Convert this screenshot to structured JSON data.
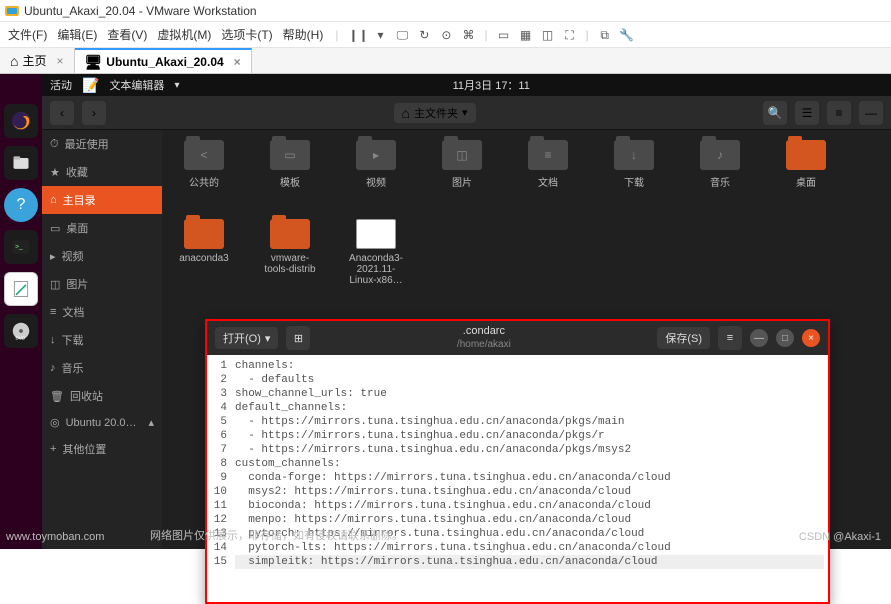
{
  "vm": {
    "title": "Ubuntu_Akaxi_20.04 - VMware Workstation",
    "menu": [
      "文件(F)",
      "编辑(E)",
      "查看(V)",
      "虚拟机(M)",
      "选项卡(T)",
      "帮助(H)"
    ],
    "tabs": {
      "home": "主页",
      "active": "Ubuntu_Akaxi_20.04"
    }
  },
  "ubuntu": {
    "topbar": {
      "activities": "活动",
      "app": "文本编辑器",
      "datetime": "11月3日 17：11"
    },
    "fm": {
      "location_btn": "主文件夹",
      "sidebar": {
        "recent": "最近使用",
        "starred": "收藏",
        "home": "主目录",
        "desktop": "桌面",
        "videos": "视频",
        "pictures": "图片",
        "documents": "文档",
        "downloads": "下载",
        "music": "音乐",
        "trash": "回收站",
        "disk": "Ubuntu 20.0…",
        "other": "其他位置"
      },
      "folders": [
        {
          "name": "公共的",
          "type": "dark",
          "ovl": "<"
        },
        {
          "name": "模板",
          "type": "dark",
          "ovl": "▭"
        },
        {
          "name": "视频",
          "type": "dark",
          "ovl": "▸"
        },
        {
          "name": "图片",
          "type": "dark",
          "ovl": "◫"
        },
        {
          "name": "文档",
          "type": "dark",
          "ovl": "≡"
        },
        {
          "name": "下载",
          "type": "dark",
          "ovl": "↓"
        },
        {
          "name": "音乐",
          "type": "dark",
          "ovl": "♪"
        },
        {
          "name": "桌面",
          "type": "orange",
          "ovl": ""
        },
        {
          "name": "anaconda3",
          "type": "orange",
          "ovl": ""
        },
        {
          "name": "vmware-tools-distrib",
          "type": "orange",
          "ovl": ""
        },
        {
          "name": "Anaconda3-2021.11-Linux-x86…",
          "type": "file",
          "ovl": ""
        }
      ]
    },
    "editor": {
      "open": "打开(O)",
      "save": "保存(S)",
      "title": ".condarc",
      "subtitle": "/home/akaxi",
      "lines": [
        "channels:",
        "  - defaults",
        "show_channel_urls: true",
        "default_channels:",
        "  - https://mirrors.tuna.tsinghua.edu.cn/anaconda/pkgs/main",
        "  - https://mirrors.tuna.tsinghua.edu.cn/anaconda/pkgs/r",
        "  - https://mirrors.tuna.tsinghua.edu.cn/anaconda/pkgs/msys2",
        "custom_channels:",
        "  conda-forge: https://mirrors.tuna.tsinghua.edu.cn/anaconda/cloud",
        "  msys2: https://mirrors.tuna.tsinghua.edu.cn/anaconda/cloud",
        "  bioconda: https://mirrors.tuna.tsinghua.edu.cn/anaconda/cloud",
        "  menpo: https://mirrors.tuna.tsinghua.edu.cn/anaconda/cloud",
        "  pytorch: https://mirrors.tuna.tsinghua.edu.cn/anaconda/cloud",
        "  pytorch-lts: https://mirrors.tuna.tsinghua.edu.cn/anaconda/cloud",
        "  simpleitk: https://mirrors.tuna.tsinghua.edu.cn/anaconda/cloud"
      ]
    }
  },
  "watermark": {
    "left": "www.toymoban.com",
    "mid": "网络图片仅供展示，非存储，如有侵权请联系删除。",
    "right": "CSDN @Akaxi-1"
  }
}
